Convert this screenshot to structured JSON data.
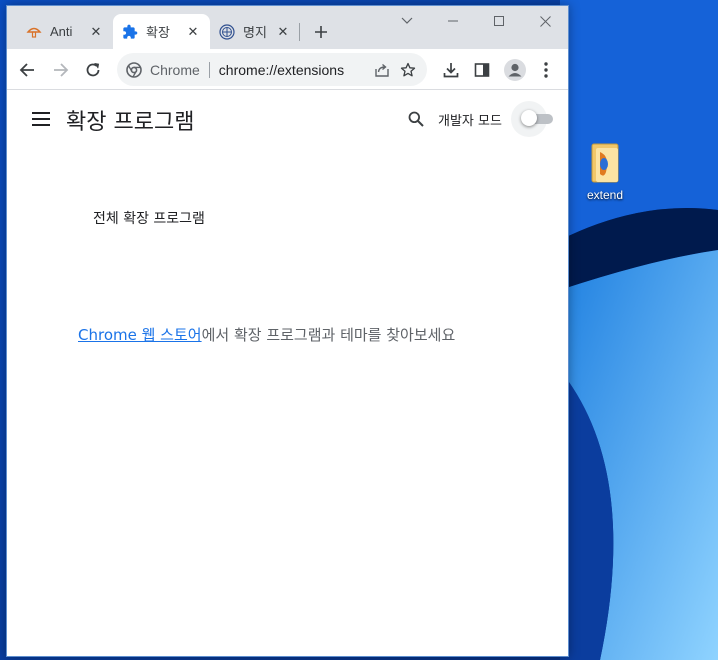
{
  "desktop": {
    "icon_label": "extend"
  },
  "browser": {
    "tabs": [
      {
        "title": "Anti",
        "favicon": "mushroom-favicon-icon",
        "active": false
      },
      {
        "title": "확장",
        "favicon": "puzzle-extension-icon",
        "active": true
      },
      {
        "title": "명지",
        "favicon": "university-seal-icon",
        "active": false
      }
    ],
    "tab_close_glyph": "✕",
    "omnibox": {
      "site_chip": "Chrome",
      "url": "chrome://extensions"
    }
  },
  "page": {
    "title": "확장 프로그램",
    "dev_mode_label": "개발자 모드",
    "dev_mode_enabled": false,
    "section_title": "전체 확장 프로그램",
    "empty_link": "Chrome 웹 스토어",
    "empty_text": "에서 확장 프로그램과 테마를 찾아보세요"
  },
  "colors": {
    "accent": "#1a73e8",
    "tabstrip": "#dee1e6",
    "wallpaper": "#0a3f9e"
  }
}
